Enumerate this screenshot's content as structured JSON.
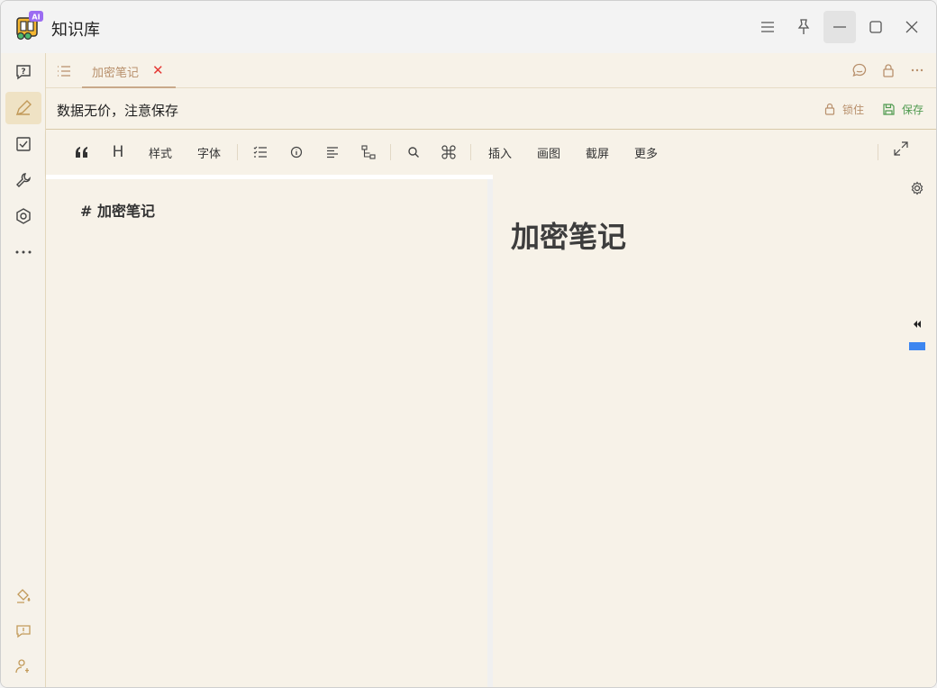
{
  "window": {
    "title": "知识库",
    "logo_badge": "AI"
  },
  "sidebar": {
    "items": [
      {
        "icon": "question-chat-icon"
      },
      {
        "icon": "edit-icon",
        "active": true
      },
      {
        "icon": "checkbox-icon"
      },
      {
        "icon": "wrench-icon"
      },
      {
        "icon": "hexagon-settings-icon"
      },
      {
        "icon": "more-dots-icon"
      }
    ],
    "bottom_items": [
      {
        "icon": "paint-bucket-icon"
      },
      {
        "icon": "feedback-icon"
      },
      {
        "icon": "user-settings-icon"
      }
    ]
  },
  "tabs": {
    "active": {
      "label": "加密笔记",
      "close": "✕"
    }
  },
  "notice": {
    "text": "数据无价，注意保存",
    "lock_label": "锁住",
    "save_label": "保存"
  },
  "toolbar": {
    "style": "样式",
    "font": "字体",
    "insert": "插入",
    "draw": "画图",
    "screenshot": "截屏",
    "more": "更多",
    "heading": "H"
  },
  "editor": {
    "line1": "#  加密笔记"
  },
  "preview": {
    "h1": "加密笔记"
  },
  "colors": {
    "accent": "#b8906c",
    "save_green": "#4f9a4f",
    "close_red": "#e53935",
    "scroll_blue": "#3d86f0"
  }
}
